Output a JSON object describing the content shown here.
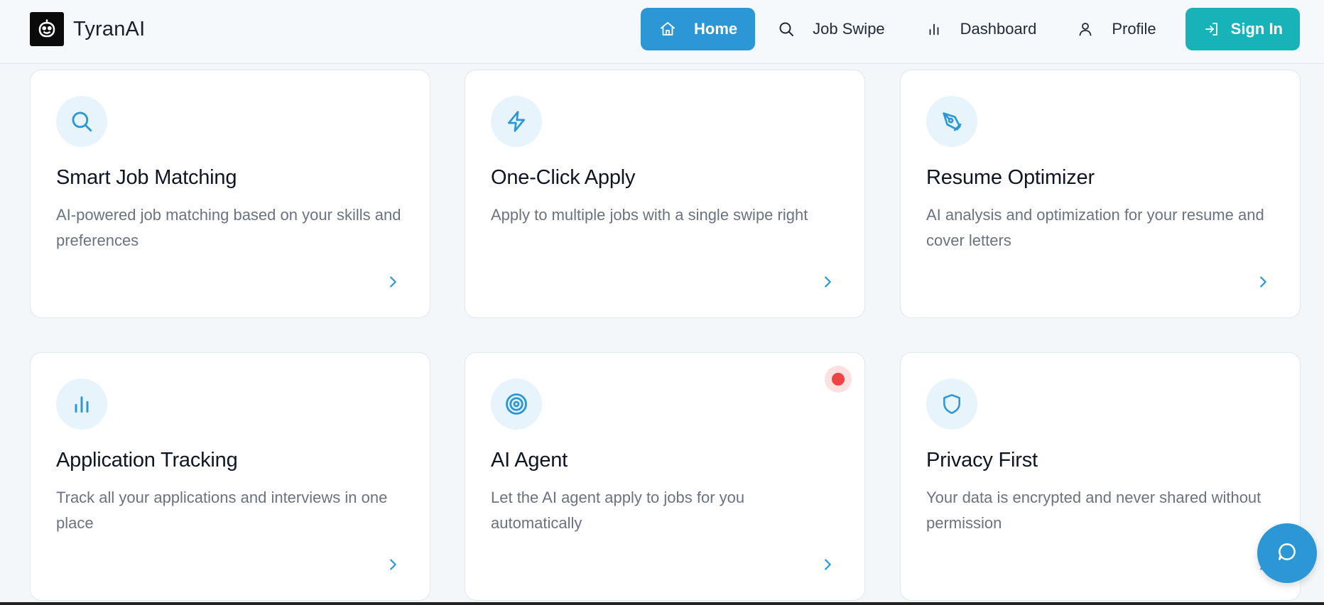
{
  "brand": {
    "name": "TyranAI",
    "logo_icon": "robot-face-icon"
  },
  "nav": {
    "items": [
      {
        "label": "Home",
        "icon": "home-icon",
        "active": true
      },
      {
        "label": "Job Swipe",
        "icon": "search-icon",
        "active": false
      },
      {
        "label": "Dashboard",
        "icon": "bar-chart-icon",
        "active": false
      },
      {
        "label": "Profile",
        "icon": "user-icon",
        "active": false
      }
    ],
    "signin": {
      "label": "Sign In",
      "icon": "login-icon"
    }
  },
  "features": [
    {
      "title": "Smart Job Matching",
      "description": "AI-powered job matching based on your skills and preferences",
      "icon": "search-icon"
    },
    {
      "title": "One-Click Apply",
      "description": "Apply to multiple jobs with a single swipe right",
      "icon": "lightning-icon"
    },
    {
      "title": "Resume Optimizer",
      "description": "AI analysis and optimization for your resume and cover letters",
      "icon": "pen-tool-icon"
    },
    {
      "title": "Application Tracking",
      "description": "Track all your applications and interviews in one place",
      "icon": "bar-chart-icon"
    },
    {
      "title": "AI Agent",
      "description": "Let the AI agent apply to jobs for you automatically",
      "icon": "target-icon",
      "badge": "notification-dot"
    },
    {
      "title": "Privacy First",
      "description": "Your data is encrypted and never shared without permission",
      "icon": "shield-icon"
    }
  ],
  "colors": {
    "primary": "#2b97d4",
    "accent": "#17b3b8",
    "badge": "#ef4444",
    "icon_bg": "#e8f4fb"
  },
  "chat": {
    "icon": "chat-bubble-icon"
  }
}
